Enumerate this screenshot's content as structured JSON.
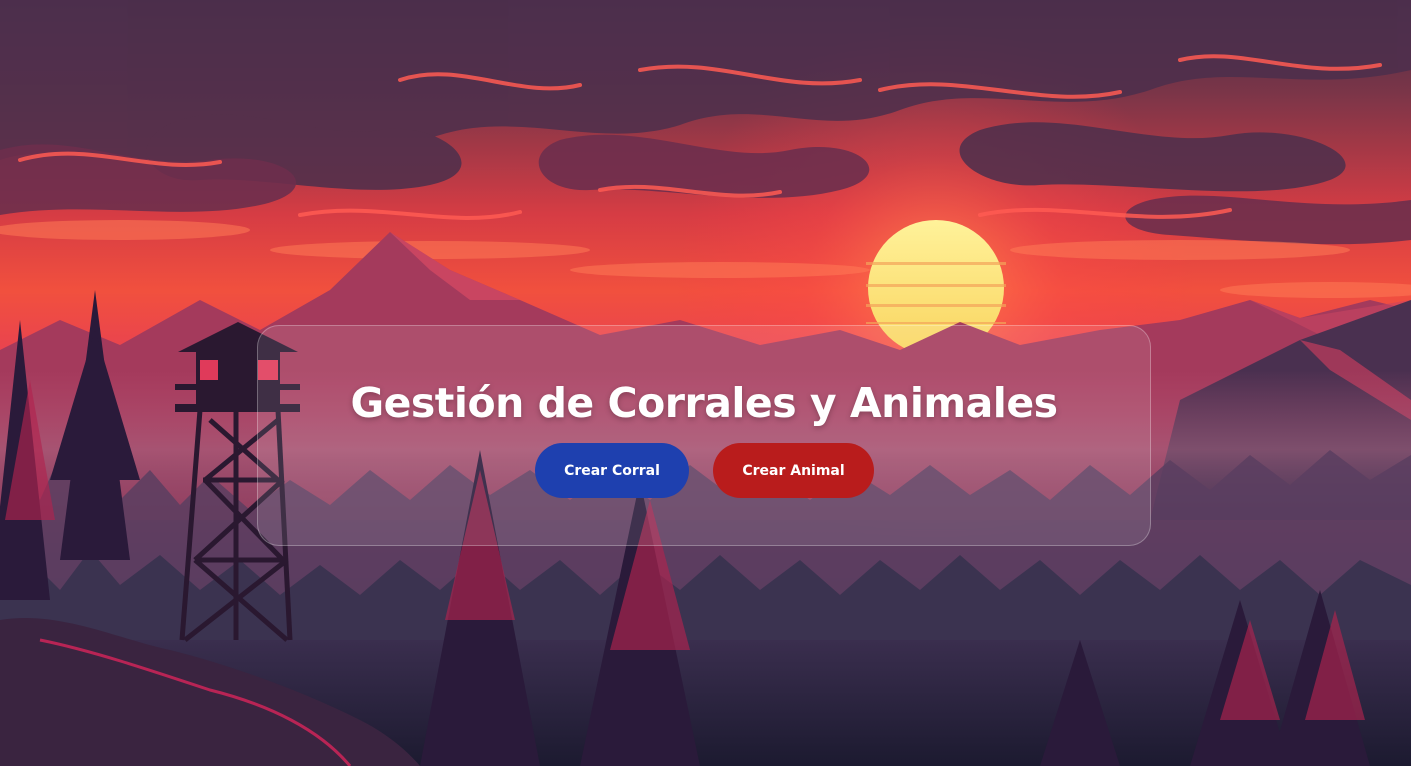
{
  "page": {
    "title": "Gestión de Corrales y Animales"
  },
  "actions": {
    "create_corral": {
      "label": "Crear Corral",
      "color": "#1e40af"
    },
    "create_animal": {
      "label": "Crear Animal",
      "color": "#b91c1c"
    }
  },
  "background": {
    "theme": "sunset-mountains-forest",
    "colors": {
      "sky_top": "#5a3050",
      "sky_glow": "#f0483e",
      "sun": "#fbe774",
      "forest": "#2b2040"
    }
  }
}
